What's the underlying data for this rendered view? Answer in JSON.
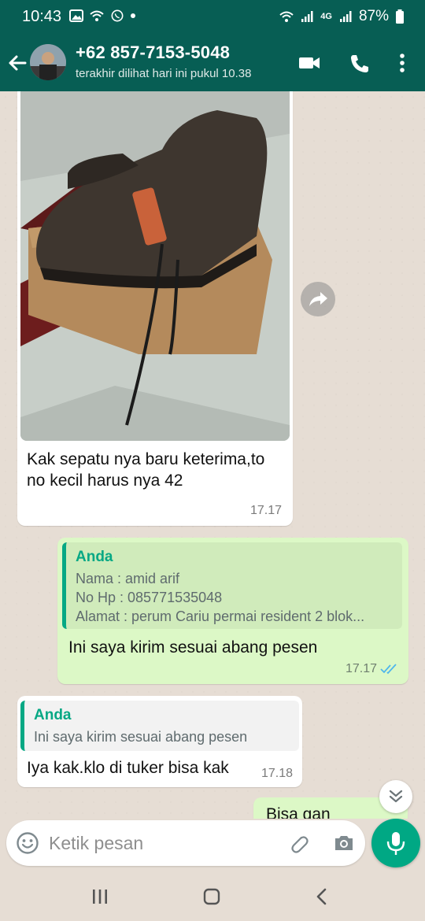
{
  "status_bar": {
    "time": "10:43",
    "network": "4G",
    "battery": "87%"
  },
  "header": {
    "contact": "+62 857-7153-5048",
    "last_seen": "terakhir dilihat hari ini pukul 10.38"
  },
  "messages": {
    "photo_message": {
      "caption": "Kak sepatu nya baru keterima,to no kecil harus nya 42",
      "time": "17.17"
    },
    "sent_message": {
      "quote_author": "Anda",
      "quote_lines": [
        "Nama : amid arif",
        "No Hp : 085771535048",
        "Alamat : perum Cariu permai resident 2 blok..."
      ],
      "text": "Ini saya kirim sesuai abang pesen",
      "time": "17.17"
    },
    "reply_message": {
      "quote_author": "Anda",
      "quote_text": "Ini saya kirim sesuai abang pesen",
      "text": "Iya kak.klo di tuker bisa kak",
      "time": "17.18"
    },
    "partial_message": {
      "text": "Bisa gan"
    }
  },
  "composer": {
    "placeholder": "Ketik pesan"
  },
  "colors": {
    "header": "#075e54",
    "outgoing_bubble": "#dcf8c6",
    "accent": "#00a884",
    "read_ticks": "#4fb6ec"
  },
  "icons": [
    "back-arrow-icon",
    "video-call-icon",
    "phone-icon",
    "menu-icon",
    "forward-icon",
    "scroll-down-icon",
    "emoji-icon",
    "attach-icon",
    "camera-icon",
    "mic-icon",
    "recents-icon",
    "home-icon",
    "nav-back-icon"
  ]
}
